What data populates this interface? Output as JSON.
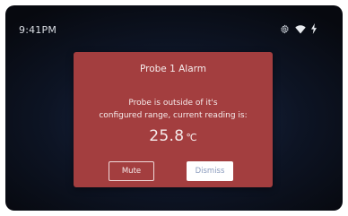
{
  "status_bar": {
    "time": "9:41PM",
    "icons": [
      "gear-icon",
      "wifi-icon",
      "power-bolt-icon"
    ]
  },
  "alarm_dialog": {
    "title": "Probe 1 Alarm",
    "message_line1": "Probe is outside of it's",
    "message_line2": "configured range, current reading is:",
    "reading_value": "25.8",
    "reading_unit": "℃",
    "mute_label": "Mute",
    "dismiss_label": "Dismiss"
  },
  "colors": {
    "dialog_background": "#a33e3f",
    "screen_background": "#0d1424",
    "dismiss_text": "#8a9bbd"
  }
}
